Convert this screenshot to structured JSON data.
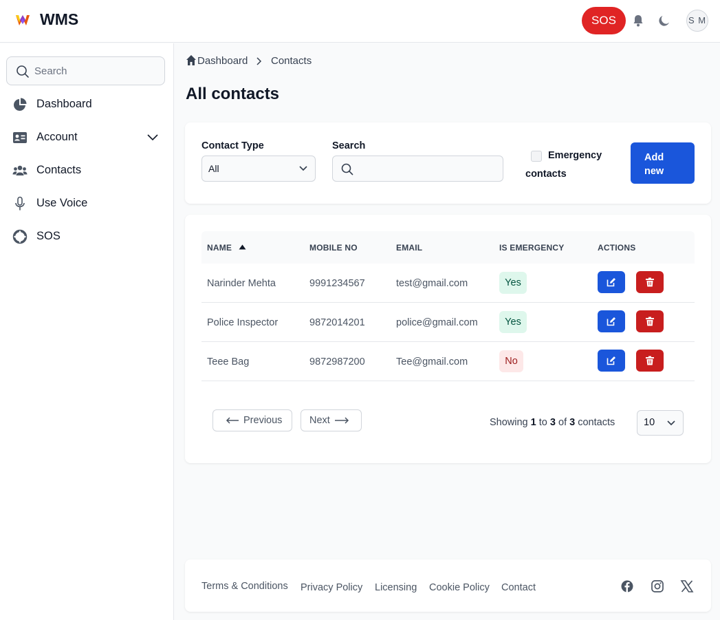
{
  "header": {
    "brand": "WMS",
    "sos_label": "SOS",
    "avatar_initials": "S M",
    "accent": "#1a56db",
    "sos_color": "#e02424"
  },
  "sidebar": {
    "search_placeholder": "Search",
    "items": [
      {
        "label": "Dashboard",
        "icon": "pie-chart-icon"
      },
      {
        "label": "Account",
        "icon": "id-card-icon"
      },
      {
        "label": "Contacts",
        "icon": "users-icon"
      },
      {
        "label": "Use Voice",
        "icon": "microphone-icon"
      },
      {
        "label": "SOS",
        "icon": "lifebuoy-icon"
      }
    ]
  },
  "breadcrumb": [
    "Dashboard",
    "Contacts"
  ],
  "page_title": "All contacts",
  "filters": {
    "contact_type_label": "Contact Type",
    "contact_type_value": "All",
    "search_label": "Search",
    "emergency_label_1": "Emergency",
    "emergency_label_2": "contacts",
    "add_new_line1": "Add",
    "add_new_line2": "new"
  },
  "table": {
    "headers": [
      "NAME",
      "MOBILE NO",
      "EMAIL",
      "IS EMERGENCY",
      "ACTIONS"
    ],
    "rows": [
      {
        "name": "Narinder Mehta",
        "mobile": "9991234567",
        "email": "test@gmail.com",
        "emergency": "Yes"
      },
      {
        "name": "Police Inspector",
        "mobile": "9872014201",
        "email": "police@gmail.com",
        "emergency": "Yes"
      },
      {
        "name": "Teee Bag",
        "mobile": "9872987200",
        "email": "Tee@gmail.com",
        "emergency": "No"
      }
    ]
  },
  "pagination": {
    "previous": "Previous",
    "next": "Next",
    "showing_prefix": "Showing",
    "from": "1",
    "to_word": "to",
    "to": "3",
    "of_word": "of",
    "total": "3",
    "suffix": "contacts",
    "per_page": "10"
  },
  "footer": {
    "links": [
      "Terms & Conditions",
      "Privacy Policy",
      "Licensing",
      "Cookie Policy",
      "Contact"
    ],
    "social": [
      "facebook-icon",
      "instagram-icon",
      "x-icon"
    ]
  }
}
